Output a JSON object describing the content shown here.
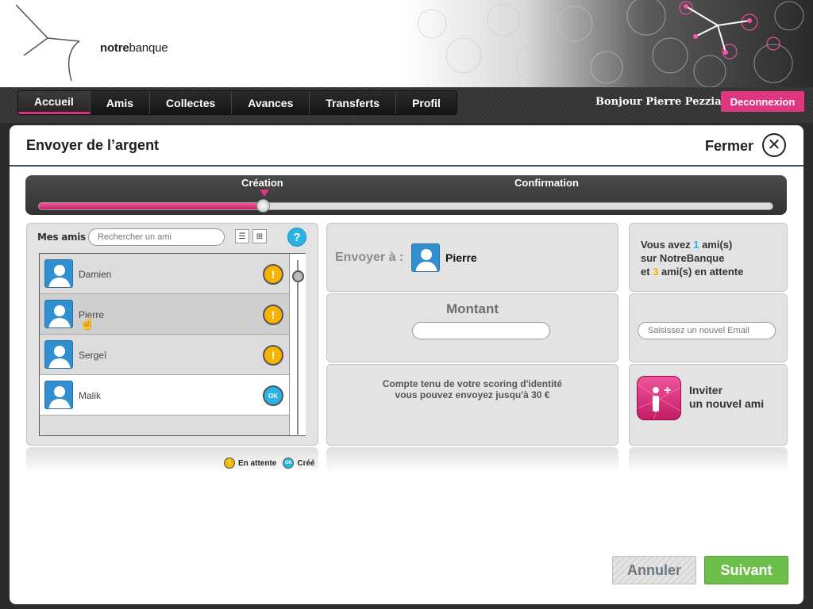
{
  "header": {
    "logo_bold": "notre",
    "logo_rest": "banque"
  },
  "nav": {
    "items": [
      "Accueil",
      "Amis",
      "Collectes",
      "Avances",
      "Transferts",
      "Profil"
    ],
    "active": "Accueil",
    "greeting": "Bonjour Pierre Pezziardi",
    "logout": "Deconnexion"
  },
  "modal": {
    "title": "Envoyer de l’argent",
    "close_label": "Fermer"
  },
  "stepper": {
    "steps": [
      "Création",
      "Confirmation"
    ],
    "current_step": "Création",
    "progress": 0.31
  },
  "friends": {
    "title": "Mes amis",
    "search_placeholder": "Rechercher un ami",
    "help": "?",
    "list": [
      {
        "name": "Damien",
        "status": "pending",
        "status_symbol": "!"
      },
      {
        "name": "Pierre",
        "status": "pending",
        "status_symbol": "!"
      },
      {
        "name": "Sergeï",
        "status": "pending",
        "status_symbol": "!"
      },
      {
        "name": "Malik",
        "status": "ok",
        "status_symbol": "OK"
      }
    ],
    "legend": {
      "pending": "En attente",
      "ok_symbol": "OK",
      "created": "Créé"
    }
  },
  "send": {
    "label": "Envoyer à :",
    "recipient": "Pierre",
    "amount_label": "Montant",
    "amount_value": "",
    "scoring_line1": "Compte tenu de votre scoring d'identité",
    "scoring_line2": "vous pouvez envoyez jusqu'à 30 €"
  },
  "info": {
    "line1_pre": "Vous avez ",
    "friends_count": "1",
    "line1_post": " ami(s)",
    "line2": "sur NotreBanque",
    "line3_pre": "et ",
    "pending_count": "3",
    "line3_post": " ami(s) en attente",
    "email_placeholder": "Saisissez un nouvel Email",
    "invite_line1": "Inviter",
    "invite_line2": "un nouvel ami"
  },
  "buttons": {
    "cancel": "Annuler",
    "next": "Suivant"
  },
  "colors": {
    "accent": "#e0357f",
    "info_blue": "#2ab3e6",
    "pending_orange": "#f6b400",
    "next_green": "#6cc04a"
  }
}
